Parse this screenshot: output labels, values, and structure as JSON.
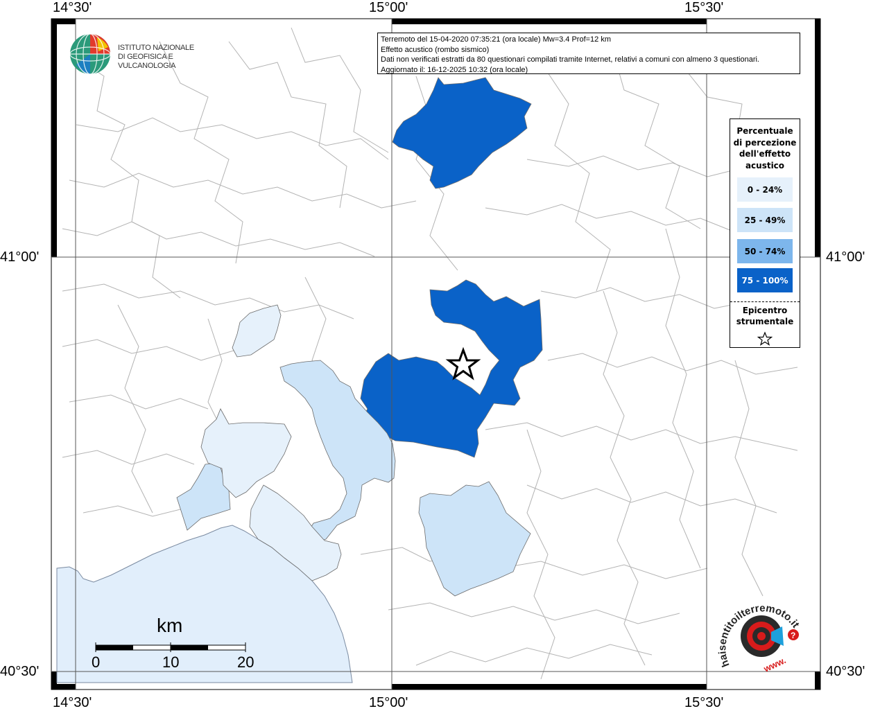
{
  "map": {
    "longitude_labels": [
      "14°30'",
      "15°00'",
      "15°30'"
    ],
    "latitude_labels": [
      "41°00'",
      "40°30'"
    ]
  },
  "info_box": {
    "line1": "Terremoto del 15-04-2020 07:35:21 (ora locale) Mw=3.4 Prof=12 km",
    "line2": "Effetto acustico (rombo sismico)",
    "line3": "Dati non verificati estratti da 80 questionari compilati tramite Internet, relativi a comuni con almeno 3 questionari.",
    "line4": "Aggiornato il: 16-12-2025 10:32 (ora locale)"
  },
  "logo_ingv": {
    "line1": "ISTITUTO NAZIONALE",
    "line2": "DI GEOFISICA E VULCANOLOGIA"
  },
  "legend": {
    "title_lines": [
      "Percentuale",
      "di percezione",
      "dell'effetto",
      "acustico"
    ],
    "classes": [
      {
        "label": "0 - 24%",
        "color": "#e6f1fb",
        "text_color": "#000000"
      },
      {
        "label": "25 - 49%",
        "color": "#cde4f8",
        "text_color": "#000000"
      },
      {
        "label": "50 - 74%",
        "color": "#7db6ec",
        "text_color": "#000000"
      },
      {
        "label": "75 - 100%",
        "color": "#0a62c8",
        "text_color": "#ffffff"
      }
    ],
    "epicenter_lines": [
      "Epicentro",
      "strumentale"
    ],
    "epicenter_symbol": "star-icon"
  },
  "scale_bar": {
    "unit": "km",
    "ticks": [
      "0",
      "10",
      "20"
    ]
  },
  "hst_logo": {
    "text": "haisentitoilterremoto.it",
    "prefix": "www."
  },
  "colors": {
    "sea": "#e1eefb",
    "boundary": "#b3b3b3",
    "graticule": "#555555"
  }
}
